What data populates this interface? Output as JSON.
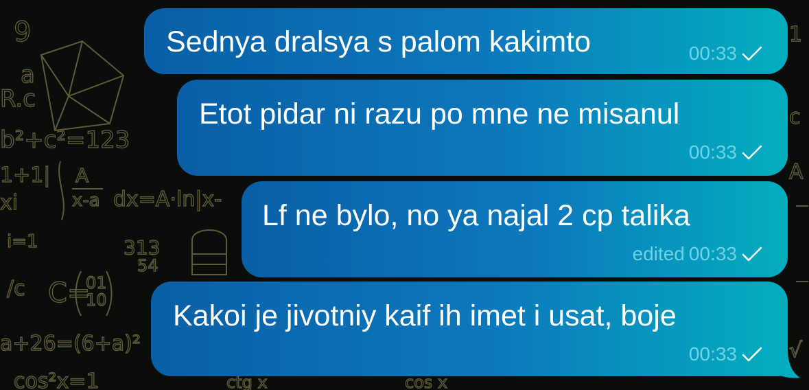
{
  "messages": [
    {
      "text": "Sednya dralsya s palom kakimto",
      "time": "00:33",
      "edited_label": ""
    },
    {
      "text": "Etot pidar ni razu po mne ne misanul",
      "time": "00:33",
      "edited_label": ""
    },
    {
      "text": "Lf ne bylo, no ya najal 2 cp talika",
      "time": "00:33",
      "edited_label": "edited"
    },
    {
      "text": "Kakoi je jivotniy kaif ih imet i usat, boje",
      "time": "00:33",
      "edited_label": ""
    }
  ],
  "colors": {
    "bubble_start": "#0a5fa6",
    "bubble_end": "#03aebf",
    "meta_text": "#6fd3e6",
    "wallpaper": "#0b0d0a"
  },
  "icons": {
    "read_status": "single-check-icon",
    "wallpaper": "math-doodles"
  }
}
